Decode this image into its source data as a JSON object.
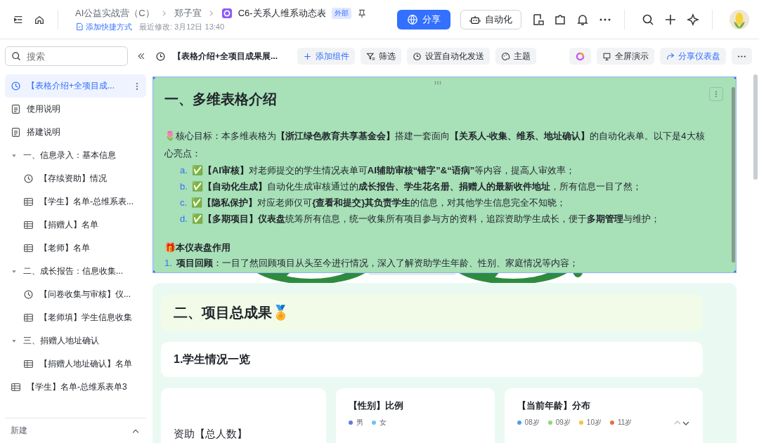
{
  "header": {
    "breadcrumbs": [
      "AI公益实战营（C）",
      "郑子宜"
    ],
    "doc_title": "C6-关系人维系动态表",
    "badge": "外部",
    "add_shortcut": "添加快捷方式",
    "modified": "最近修改: 3月12日 13:40",
    "share_button": "分享",
    "automation_button": "自动化"
  },
  "sidebar": {
    "search": {
      "placeholder": "搜索"
    },
    "items": [
      {
        "kind": "dashboard",
        "label": "【表格介绍+全项目成...",
        "selected": true
      },
      {
        "kind": "doc",
        "label": "使用说明",
        "selected": false
      },
      {
        "kind": "doc",
        "label": "搭建说明",
        "selected": false
      },
      {
        "kind": "group",
        "label": "一、信息录入：基本信息",
        "expanded": true,
        "children": [
          {
            "kind": "dashboard",
            "label": "【存续资助】情况",
            "selected": false
          },
          {
            "kind": "table",
            "label": "【学生】名单-总维系表...",
            "selected": false
          },
          {
            "kind": "table",
            "label": "【捐赠人】名单",
            "selected": false
          },
          {
            "kind": "table",
            "label": "【老师】名单",
            "selected": false
          }
        ]
      },
      {
        "kind": "group",
        "label": "二、成长报告：信息收集...",
        "expanded": true,
        "children": [
          {
            "kind": "dashboard",
            "label": "【问卷收集与审核】仪...",
            "selected": false
          },
          {
            "kind": "table",
            "label": "【老师填】学生信息收集",
            "selected": false
          }
        ]
      },
      {
        "kind": "group",
        "label": "三、捐赠人地址确认",
        "expanded": true,
        "children": [
          {
            "kind": "table",
            "label": "【捐赠人地址确认】名单",
            "selected": false
          }
        ]
      },
      {
        "kind": "table",
        "label": "【学生】名单-总维系表单3",
        "selected": false
      }
    ],
    "new_button": "新建"
  },
  "toolbar": {
    "title": "【表格介绍+全项目成果展...",
    "actions": [
      {
        "kind": "add",
        "label": "添加组件"
      },
      {
        "kind": "filter",
        "label": "筛选"
      },
      {
        "kind": "auto",
        "label": "设置自动化发送"
      },
      {
        "kind": "theme",
        "label": "主题"
      }
    ],
    "present_button": "全屏演示",
    "share_dashboard_button": "分享仪表盘"
  },
  "intro": {
    "heading": "一、多维表格介绍",
    "paragraph": "🌷核心目标：本多维表格为**【浙江绿色教育共享基金会】**搭建一套面向**【关系人-收集、维系、地址确认】**的自动化表单。以下是4大核心亮点：",
    "highlights": [
      {
        "marker": "a.",
        "text": "✅**【AI审核】**对老师提交的学生情况表单可**AI辅助审核“错字”&“语病”**等内容，提高人审效率；"
      },
      {
        "marker": "b.",
        "text": "✅**【自动化生成】**自动化生成审核通过的**成长报告、学生花名册、捐赠人的最新收件地址**，所有信息一目了然；"
      },
      {
        "marker": "c.",
        "text": "✅**【隐私保护】**对应老师仅可**{查看和提交}其负责学生**的信息，对其他学生信息完全不知晓；"
      },
      {
        "marker": "d.",
        "text": "✅**【多期项目】仪表盘**统筹所有信息，统一收集所有项目参与方的资料，追踪资助学生成长，便于**多期管理**与维护；"
      }
    ],
    "subheading": "🎁本仪表盘作用",
    "uses": [
      {
        "marker": "1.",
        "text": "**项目回顾**：一目了然回顾项目从头至今进行情况，深入了解资助学生年龄、性别、家庭情况等内容；"
      }
    ]
  },
  "results": {
    "title": "二、项目总成果🏅",
    "subtitle": "1.学生情况一览",
    "cards": [
      {
        "title": "资助【总人数】"
      },
      {
        "title": "【性别】比例",
        "legend": [
          {
            "label": "男",
            "color": "#5b7be8"
          },
          {
            "label": "女",
            "color": "#6cc4f0"
          }
        ]
      },
      {
        "title": "【当前年龄】分布",
        "legend": [
          {
            "label": "08岁",
            "color": "#4ea0ee"
          },
          {
            "label": "09岁",
            "color": "#8fd57a"
          },
          {
            "label": "10岁",
            "color": "#f5c242"
          },
          {
            "label": "11岁",
            "color": "#e8703a"
          }
        ]
      }
    ]
  }
}
